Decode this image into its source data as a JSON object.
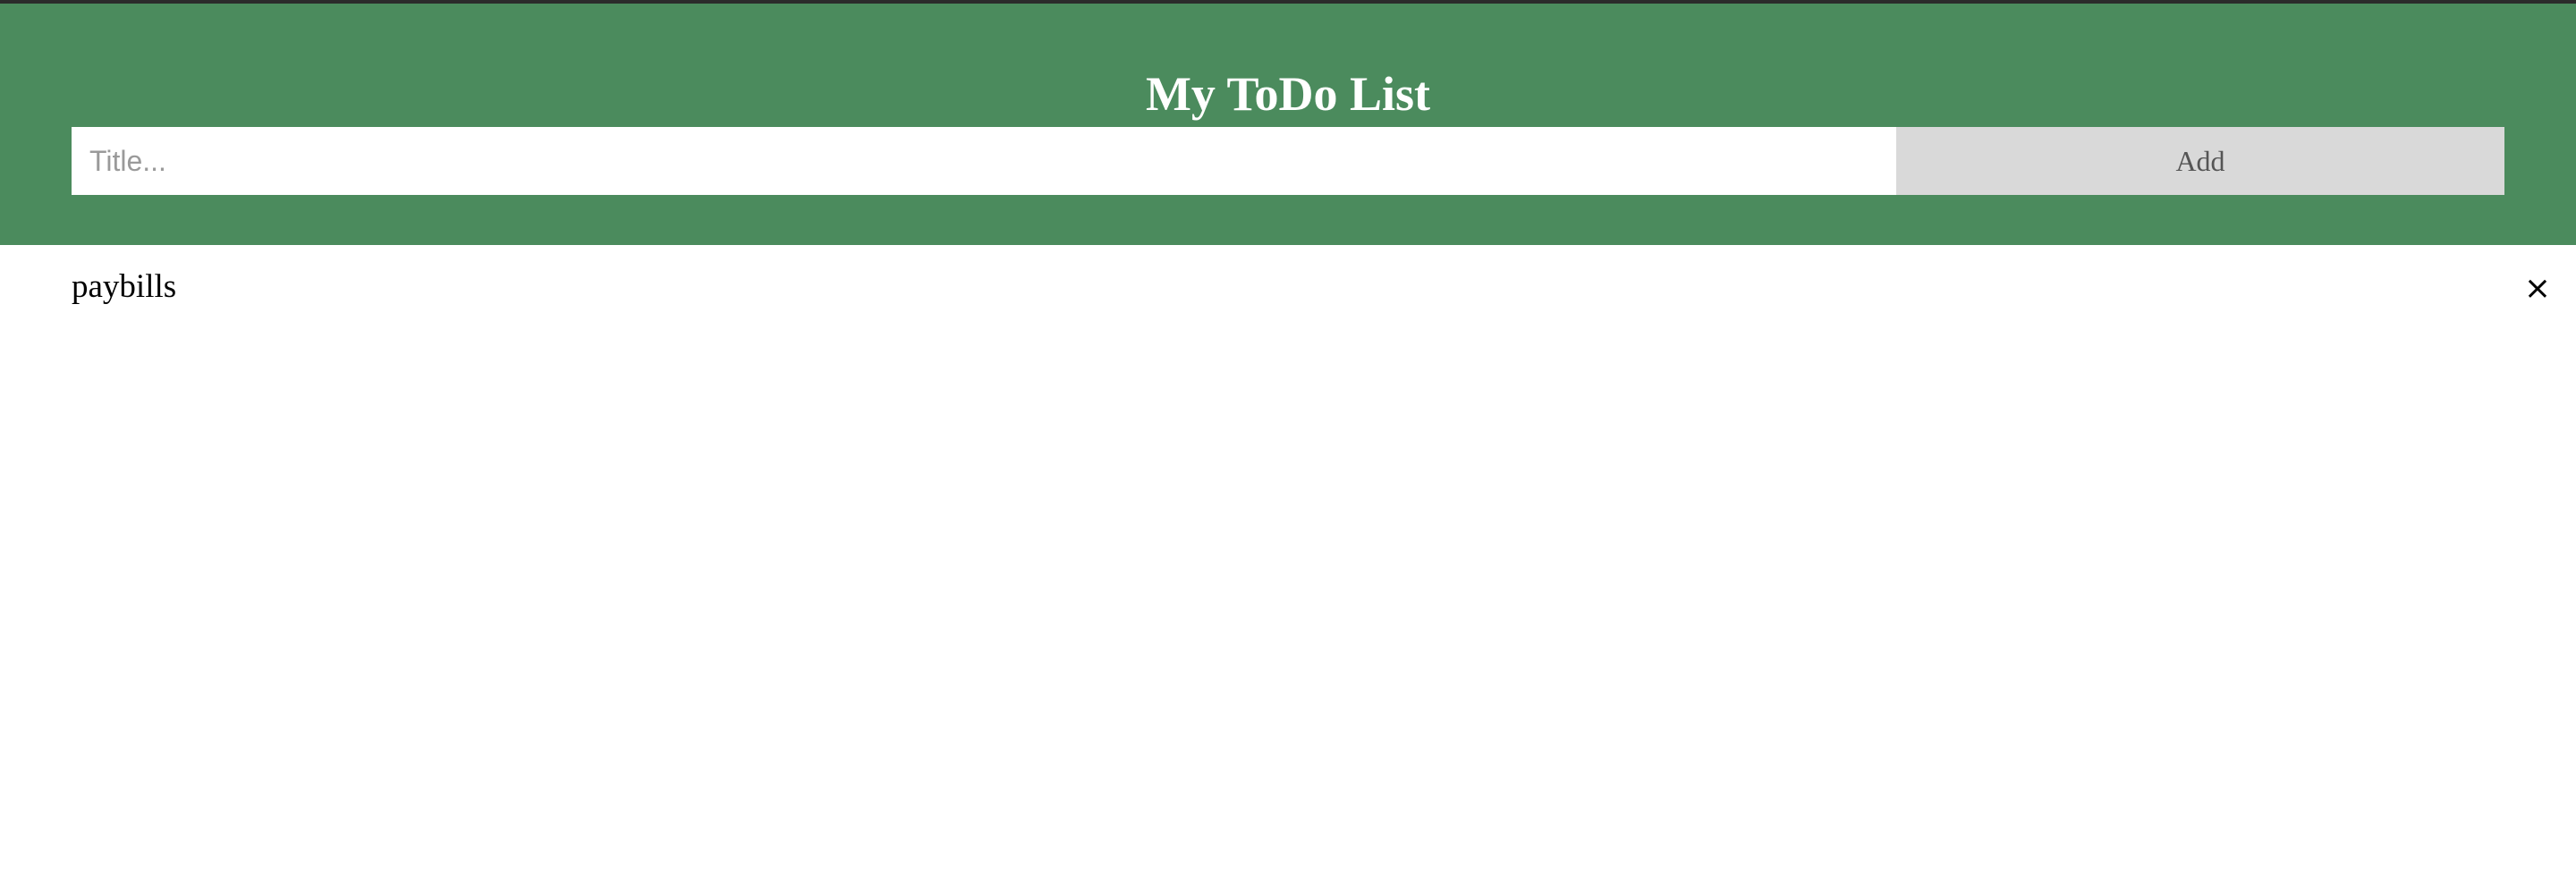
{
  "header": {
    "title": "My ToDo List",
    "input_placeholder": "Title...",
    "input_value": "",
    "add_label": "Add",
    "background_color": "#4b8b5d"
  },
  "todos": [
    {
      "text": "paybills",
      "close_icon": "close-icon",
      "close_glyph": "×"
    }
  ]
}
